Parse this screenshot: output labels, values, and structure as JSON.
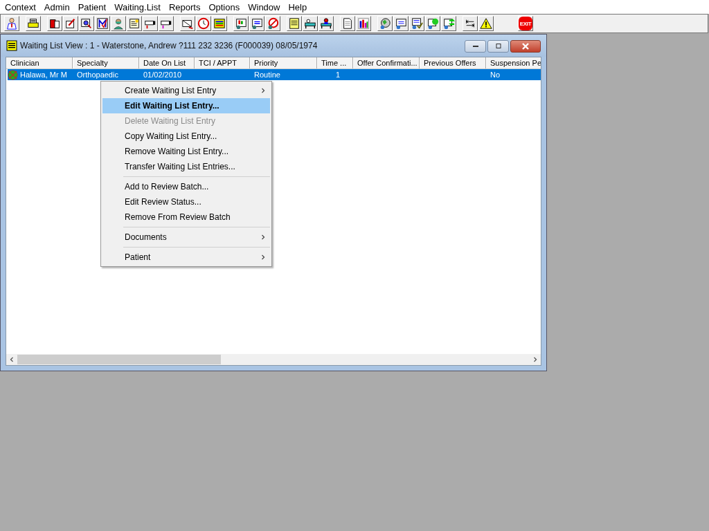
{
  "menu_bar": [
    "Context",
    "Admin",
    "Patient",
    "Waiting.List",
    "Reports",
    "Options",
    "Window",
    "Help"
  ],
  "toolbar": {
    "exit_label": "EXIT"
  },
  "window": {
    "title": "Waiting List View :  1 - Waterstone, Andrew ?111 232 3236 (F000039) 08/05/1974"
  },
  "table": {
    "columns": [
      "Clinician",
      "Specialty",
      "Date On List",
      "TCI / APPT",
      "Priority",
      "Time ...",
      "Offer Confirmati...",
      "Previous Offers",
      "Suspension Pe"
    ],
    "rows": [
      {
        "selected": true,
        "cells": [
          "Halawa, Mr M",
          "Orthopaedic",
          "01/02/2010",
          "",
          "Routine",
          "1",
          "",
          "",
          "No"
        ]
      }
    ]
  },
  "context_menu": [
    {
      "kind": "item",
      "label": "Create Waiting List Entry",
      "submenu": true,
      "selected": false,
      "disabled": false
    },
    {
      "kind": "item",
      "label": "Edit Waiting List Entry...",
      "submenu": false,
      "selected": true,
      "disabled": false
    },
    {
      "kind": "item",
      "label": "Delete Waiting List Entry",
      "submenu": false,
      "selected": false,
      "disabled": true
    },
    {
      "kind": "item",
      "label": "Copy Waiting List Entry...",
      "submenu": false,
      "selected": false,
      "disabled": false
    },
    {
      "kind": "item",
      "label": "Remove Waiting List Entry...",
      "submenu": false,
      "selected": false,
      "disabled": false
    },
    {
      "kind": "item",
      "label": "Transfer Waiting List Entries...",
      "submenu": false,
      "selected": false,
      "disabled": false
    },
    {
      "kind": "separator"
    },
    {
      "kind": "item",
      "label": "Add to Review Batch...",
      "submenu": false,
      "selected": false,
      "disabled": false
    },
    {
      "kind": "item",
      "label": "Edit Review Status...",
      "submenu": false,
      "selected": false,
      "disabled": false
    },
    {
      "kind": "item",
      "label": "Remove From Review Batch",
      "submenu": false,
      "selected": false,
      "disabled": false
    },
    {
      "kind": "separator"
    },
    {
      "kind": "item",
      "label": "Documents",
      "submenu": true,
      "selected": false,
      "disabled": false
    },
    {
      "kind": "separator"
    },
    {
      "kind": "item",
      "label": "Patient",
      "submenu": true,
      "selected": false,
      "disabled": false
    }
  ]
}
